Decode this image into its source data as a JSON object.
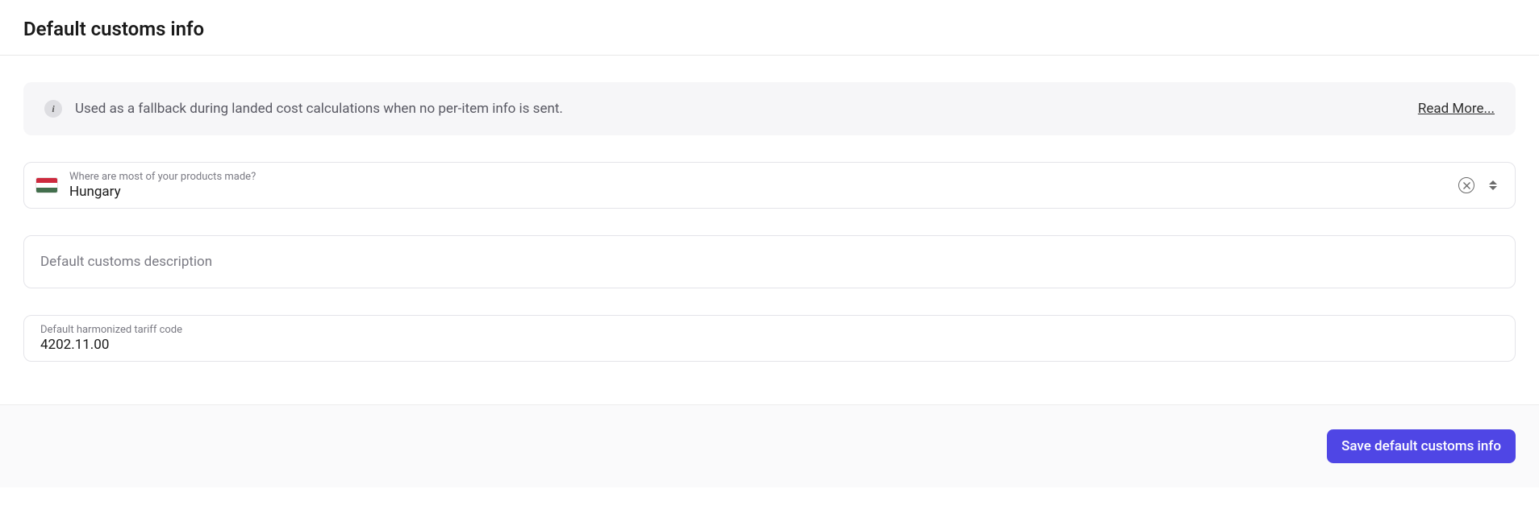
{
  "header": {
    "title": "Default customs info"
  },
  "info_banner": {
    "text": "Used as a fallback during landed cost calculations when no per-item info is sent.",
    "read_more": "Read More...",
    "icon": "info-icon"
  },
  "fields": {
    "country": {
      "label": "Where are most of your products made?",
      "value": "Hungary"
    },
    "description": {
      "placeholder": "Default customs description",
      "value": ""
    },
    "tariff": {
      "label": "Default harmonized tariff code",
      "value": "4202.11.00"
    }
  },
  "footer": {
    "save_label": "Save default customs info"
  }
}
